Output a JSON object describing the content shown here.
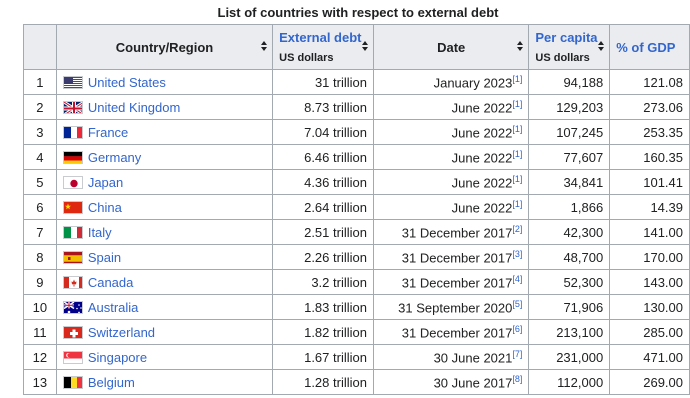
{
  "caption": "List of countries with respect to external debt",
  "headers": {
    "rank": "",
    "country": "Country/Region",
    "debt": "External debt",
    "debt_unit": "US dollars",
    "date": "Date",
    "percap": "Per capita",
    "percap_unit": "US dollars",
    "gdp": "% of GDP"
  },
  "rows": [
    {
      "rank": "1",
      "country": "United States",
      "flag": "flag-us-icon",
      "debt": "31 trillion",
      "date": "January 2023",
      "ref": "[1]",
      "percap": "94,188",
      "gdp": "121.08"
    },
    {
      "rank": "2",
      "country": "United Kingdom",
      "flag": "flag-uk-icon",
      "debt": "8.73 trillion",
      "date": "June 2022",
      "ref": "[1]",
      "percap": "129,203",
      "gdp": "273.06"
    },
    {
      "rank": "3",
      "country": "France",
      "flag": "flag-fr-icon",
      "debt": "7.04 trillion",
      "date": "June 2022",
      "ref": "[1]",
      "percap": "107,245",
      "gdp": "253.35"
    },
    {
      "rank": "4",
      "country": "Germany",
      "flag": "flag-de-icon",
      "debt": "6.46 trillion",
      "date": "June 2022",
      "ref": "[1]",
      "percap": "77,607",
      "gdp": "160.35"
    },
    {
      "rank": "5",
      "country": "Japan",
      "flag": "flag-jp-icon",
      "debt": "4.36 trillion",
      "date": "June 2022",
      "ref": "[1]",
      "percap": "34,841",
      "gdp": "101.41"
    },
    {
      "rank": "6",
      "country": "China",
      "flag": "flag-cn-icon",
      "debt": "2.64 trillion",
      "date": "June 2022",
      "ref": "[1]",
      "percap": "1,866",
      "gdp": "14.39"
    },
    {
      "rank": "7",
      "country": "Italy",
      "flag": "flag-it-icon",
      "debt": "2.51 trillion",
      "date": "31 December 2017",
      "ref": "[2]",
      "percap": "42,300",
      "gdp": "141.00"
    },
    {
      "rank": "8",
      "country": "Spain",
      "flag": "flag-es-icon",
      "debt": "2.26 trillion",
      "date": "31 December 2017",
      "ref": "[3]",
      "percap": "48,700",
      "gdp": "170.00"
    },
    {
      "rank": "9",
      "country": "Canada",
      "flag": "flag-ca-icon",
      "debt": "3.2 trillion",
      "date": "31 December 2017",
      "ref": "[4]",
      "percap": "52,300",
      "gdp": "143.00"
    },
    {
      "rank": "10",
      "country": "Australia",
      "flag": "flag-au-icon",
      "debt": "1.83 trillion",
      "date": "31 September 2020",
      "ref": "[5]",
      "percap": "71,906",
      "gdp": "130.00"
    },
    {
      "rank": "11",
      "country": "Switzerland",
      "flag": "flag-ch-icon",
      "debt": "1.82 trillion",
      "date": "31 December 2017",
      "ref": "[6]",
      "percap": "213,100",
      "gdp": "285.00"
    },
    {
      "rank": "12",
      "country": "Singapore",
      "flag": "flag-sg-icon",
      "debt": "1.67 trillion",
      "date": "30 June 2021",
      "ref": "[7]",
      "percap": "231,000",
      "gdp": "471.00"
    },
    {
      "rank": "13",
      "country": "Belgium",
      "flag": "flag-be-icon",
      "debt": "1.28 trillion",
      "date": "30 June 2017",
      "ref": "[8]",
      "percap": "112,000",
      "gdp": "269.00"
    }
  ],
  "colors": {
    "link": "#3366cc",
    "header_bg": "#eaecf0",
    "border": "#a2a9b1"
  }
}
